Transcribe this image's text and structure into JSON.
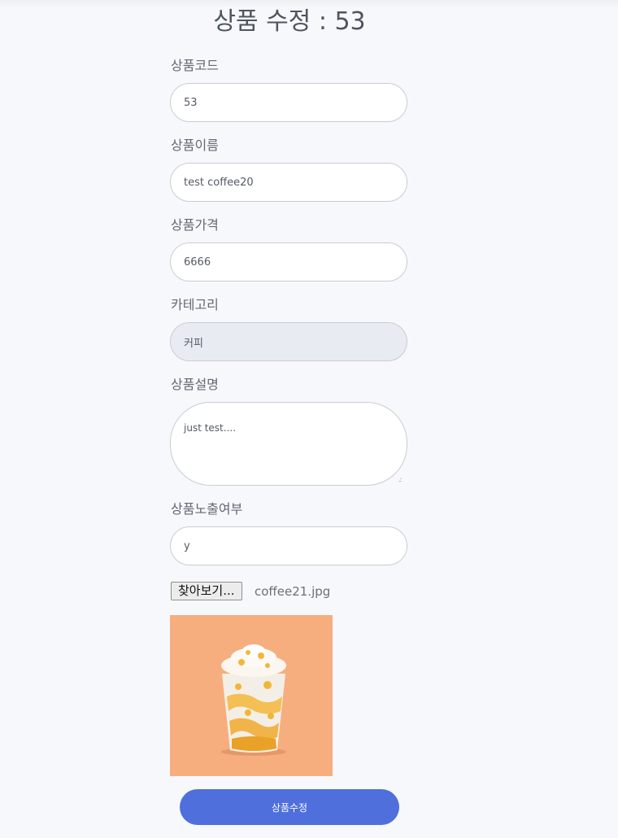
{
  "page": {
    "title": "상품 수정 : 53"
  },
  "form": {
    "code": {
      "label": "상품코드",
      "value": "53"
    },
    "name": {
      "label": "상품이름",
      "value": "test coffee20"
    },
    "price": {
      "label": "상품가격",
      "value": "6666"
    },
    "category": {
      "label": "카테고리",
      "value": "커피"
    },
    "description": {
      "label": "상품설명",
      "value": "just test...."
    },
    "visibility": {
      "label": "상품노출여부",
      "value": "y"
    },
    "file": {
      "button_label": "찾아보기...",
      "file_name": "coffee21.jpg"
    },
    "submit_label": "상품수정"
  },
  "colors": {
    "accent": "#4f6fdc",
    "page_background": "#f7f8fc",
    "readonly_background": "#e9ebf3",
    "image_background": "#f4a877"
  }
}
